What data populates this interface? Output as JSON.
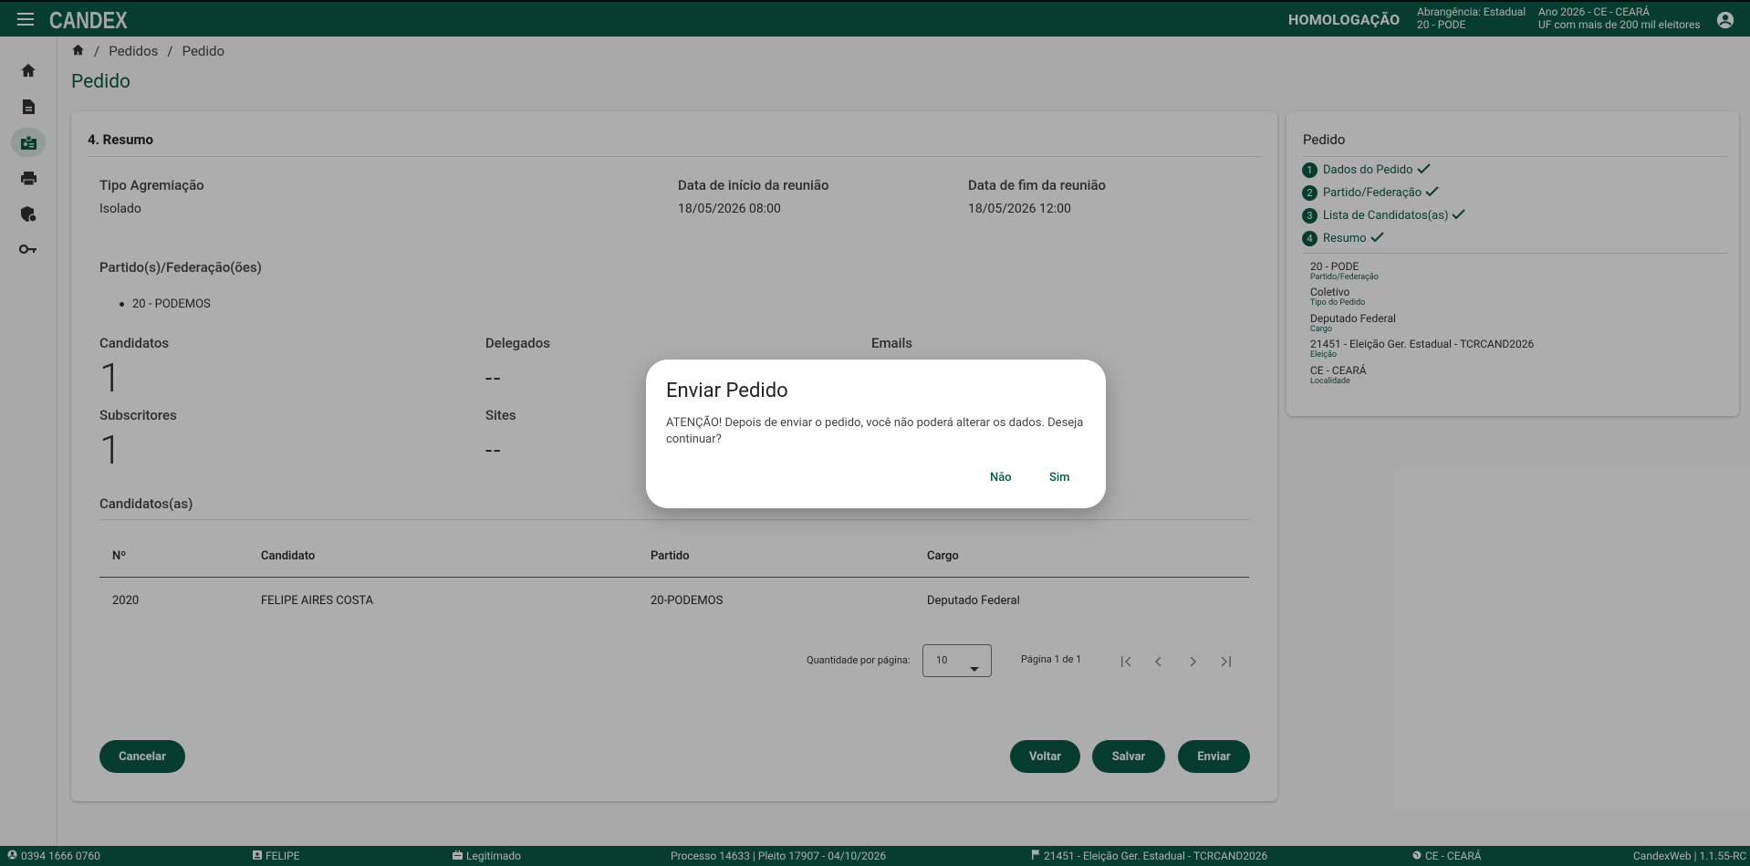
{
  "header": {
    "logo": "CANDEX",
    "environment": "HOMOLOGAÇÃO",
    "abrangencia_line1": "Abrangência: Estadual",
    "abrangencia_line2": "20 - PODE",
    "ano_line1": "Ano 2026 - CE - CEARÁ",
    "ano_line2": "UF com mais de 200 mil eleitores"
  },
  "sidebar": {
    "items": [
      {
        "icon": "home-icon"
      },
      {
        "icon": "document-icon"
      },
      {
        "icon": "badge-icon"
      },
      {
        "icon": "printer-icon"
      },
      {
        "icon": "shield-icon"
      },
      {
        "icon": "key-icon"
      }
    ]
  },
  "breadcrumb": {
    "sep1": "/",
    "item1": "Pedidos",
    "sep2": "/",
    "item2": "Pedido"
  },
  "page_title": "Pedido",
  "summary": {
    "section_title": "4. Resumo",
    "tipo_label": "Tipo Agremiação",
    "tipo_value": "Isolado",
    "inicio_label": "Data de início da reunião",
    "inicio_value": "18/05/2026 08:00",
    "fim_label": "Data de fim da reunião",
    "fim_value": "18/05/2026 12:00",
    "partidos_label": "Partido(s)/Federação(ões)",
    "partidos": [
      "20 - PODEMOS"
    ],
    "candidatos_label": "Candidatos",
    "candidatos_value": "1",
    "delegados_label": "Delegados",
    "delegados_value": "--",
    "emails_label": "Emails",
    "subscritores_label": "Subscritores",
    "subscritores_value": "1",
    "sites_label": "Sites",
    "sites_value": "--",
    "candidatos_section": "Candidatos(as)"
  },
  "table": {
    "headers": [
      "Nº",
      "Candidato",
      "Partido",
      "Cargo"
    ],
    "rows": [
      [
        "2020",
        "FELIPE AIRES COSTA",
        "20-PODEMOS",
        "Deputado Federal"
      ]
    ]
  },
  "pagination": {
    "per_page_label": "Quantidade por página:",
    "per_page_value": "10",
    "page_info": "Página 1 de 1"
  },
  "buttons": {
    "cancelar": "Cancelar",
    "voltar": "Voltar",
    "salvar": "Salvar",
    "enviar": "Enviar"
  },
  "steps_panel": {
    "title": "Pedido",
    "steps": [
      {
        "n": "1",
        "label": "Dados do Pedido"
      },
      {
        "n": "2",
        "label": "Partido/Federação"
      },
      {
        "n": "3",
        "label": "Lista de Candidatos(as)"
      },
      {
        "n": "4",
        "label": "Resumo"
      }
    ],
    "details": [
      {
        "value": "20 - PODE",
        "key": "Partido/Federação"
      },
      {
        "value": "Coletivo",
        "key": "Tipo do Pedido"
      },
      {
        "value": "Deputado Federal",
        "key": "Cargo"
      },
      {
        "value": "21451 - Eleição Ger. Estadual - TCRCAND2026",
        "key": "Eleição"
      },
      {
        "value": "CE - CEARÁ",
        "key": "Localidade"
      }
    ]
  },
  "dialog": {
    "title": "Enviar Pedido",
    "message": "ATENÇÃO! Depois de enviar o pedido, você não poderá alterar os dados. Deseja continuar?",
    "no": "Não",
    "yes": "Sim"
  },
  "statusbar": {
    "phone": "0394 1666 0760",
    "user": "FELIPE",
    "role": "Legitimado",
    "processo": "Processo 14633 | Pleito 17907 - 04/10/2026",
    "eleicao": "21451 - Eleição Ger. Estadual - TCRCAND2026",
    "local": "CE - CEARÁ",
    "version": "CandexWeb | 1.1.55-RC"
  },
  "colors": {
    "primary": "#0b5a47",
    "overlay": "rgba(0,0,0,0.32)"
  }
}
